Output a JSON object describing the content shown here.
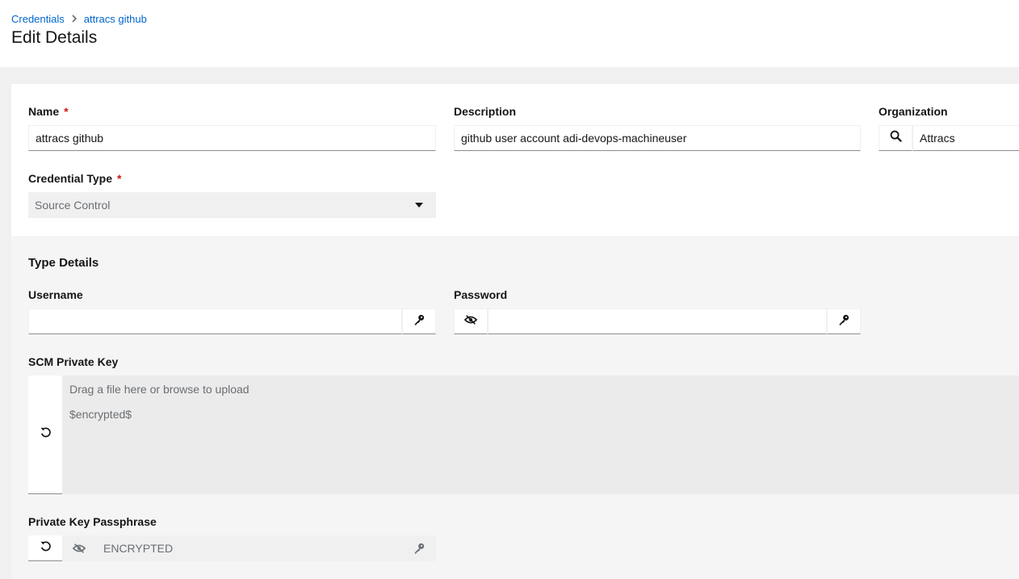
{
  "breadcrumb": {
    "root": "Credentials",
    "current": "attracs github"
  },
  "page": {
    "title": "Edit Details"
  },
  "form": {
    "name": {
      "label": "Name",
      "required": "*",
      "value": "attracs github"
    },
    "description": {
      "label": "Description",
      "value": "github user account adi-devops-machineuser"
    },
    "organization": {
      "label": "Organization",
      "value": "Attracs"
    },
    "credential_type": {
      "label": "Credential Type",
      "required": "*",
      "value": "Source Control"
    }
  },
  "type_details": {
    "title": "Type Details",
    "username": {
      "label": "Username",
      "value": ""
    },
    "password": {
      "label": "Password",
      "value": ""
    },
    "scm_private_key": {
      "label": "SCM Private Key",
      "placeholder": "Drag a file here or browse to upload",
      "value": "$encrypted$"
    },
    "private_key_passphrase": {
      "label": "Private Key Passphrase",
      "value": "ENCRYPTED"
    }
  },
  "icons": {
    "search": "search-icon",
    "key": "key-icon",
    "eye_slash": "eye-slash-icon",
    "undo": "undo-icon",
    "caret": "caret-down-icon"
  },
  "colors": {
    "link": "#0066cc",
    "required": "#c9190b"
  }
}
